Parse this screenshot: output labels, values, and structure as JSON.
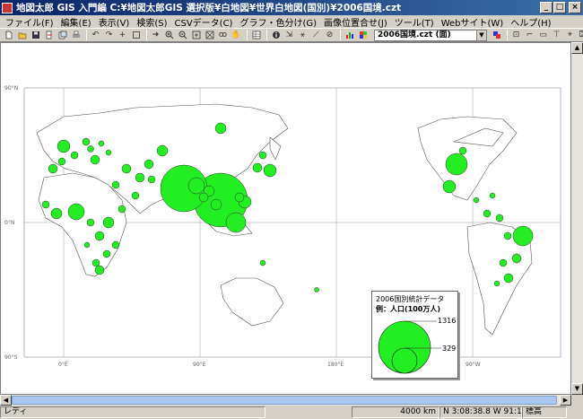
{
  "window": {
    "title": "地図太郎 GIS 入門編   C:¥地図太郎GIS 選択版¥白地図¥世界白地図(国別)¥2006国境.czt",
    "min": "_",
    "max": "□",
    "close": "×"
  },
  "menu": [
    "ファイル(F)",
    "編集(E)",
    "表示(V)",
    "検索(S)",
    "CSVデータ(C)",
    "グラフ・色分け(G)",
    "画像位置合せ(J)",
    "ツール(T)",
    "Webサイト(W)",
    "ヘルプ(H)"
  ],
  "toolbar": {
    "layer_select": "2006国境.czt (面)"
  },
  "map": {
    "lat_labels": [
      "90°N",
      "0°N",
      "90°S"
    ],
    "lon_labels": [
      "0°E",
      "90°E",
      "180°E",
      "90°W"
    ],
    "land_color": "#ffffff",
    "circle_color": "#22ee22"
  },
  "legend": {
    "title": "2006国別統計データ",
    "subtitle": "例：人口(100万人)",
    "max_value": "1316",
    "ref_value": "329"
  },
  "statusbar": {
    "ready": "レディ",
    "scale": "4000 km",
    "coords": "N 3:08:38.8   W 91:16:17.2",
    "altitude": "標高"
  }
}
